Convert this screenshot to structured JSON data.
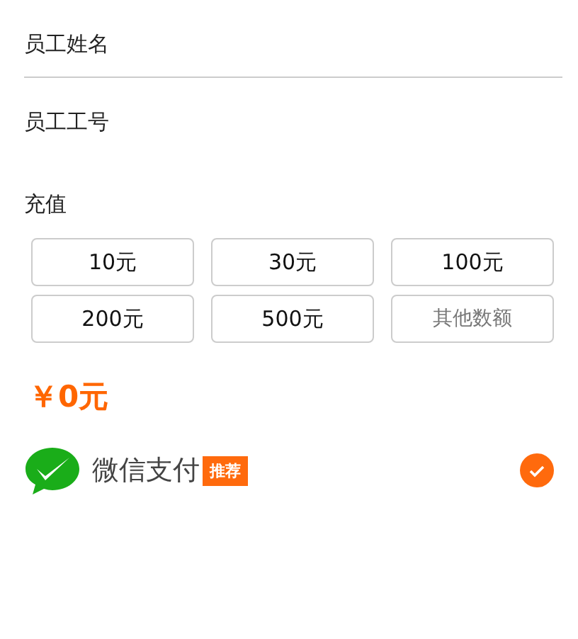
{
  "fields": [
    {
      "placeholder": "员工姓名"
    },
    {
      "placeholder": "员工工号"
    }
  ],
  "recharge": {
    "title": "充值",
    "options": [
      {
        "label": "10元",
        "kind": "amount",
        "selected": false
      },
      {
        "label": "30元",
        "kind": "amount",
        "selected": false
      },
      {
        "label": "100元",
        "kind": "amount",
        "selected": false
      },
      {
        "label": "200元",
        "kind": "amount",
        "selected": false
      },
      {
        "label": "500元",
        "kind": "amount",
        "selected": false
      },
      {
        "label": "其他数额",
        "kind": "other",
        "selected": false
      }
    ],
    "total": "￥0元"
  },
  "payment": {
    "name": "微信支付",
    "badge": "推荐",
    "selected": true
  }
}
